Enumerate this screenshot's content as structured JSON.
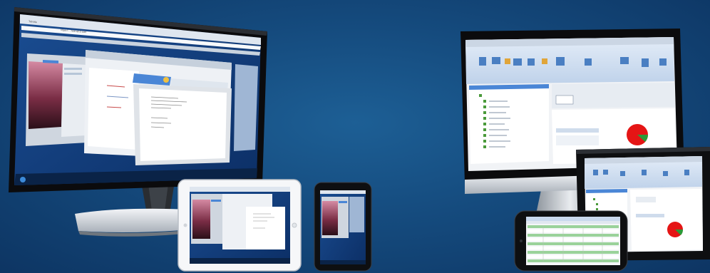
{
  "scene": {
    "background": "#154b7e",
    "devices": [
      "desktop-monitor",
      "white-tablet",
      "black-smartphone",
      "imac-monitor",
      "black-tablet",
      "landscape-smartphone"
    ]
  },
  "left_browser": {
    "tab_label": "Tab title",
    "address_text": "https://… host ap.cl.com"
  },
  "colors": {
    "bezel": "#0b0b0d",
    "screen_blue": "#0f3a78",
    "window_chrome": "#dfe6ef",
    "office_ribbon": "#c9d9ee",
    "pie_red": "#e51515",
    "pie_green": "#2b9a38",
    "highlight_green": "#9ad29a"
  }
}
